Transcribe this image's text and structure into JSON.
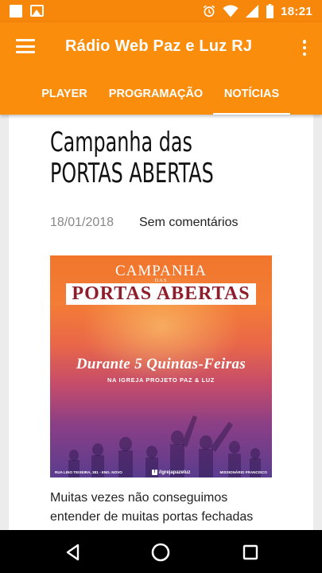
{
  "status_bar": {
    "time": "18:21",
    "left_icons": [
      "notification-square-icon",
      "image-icon"
    ],
    "right_icons": [
      "alarm-icon",
      "wifi-icon",
      "signal-icon",
      "battery-icon"
    ]
  },
  "app_bar": {
    "title": "Rádio Web Paz e Luz RJ",
    "tabs": [
      {
        "label": "PLAYER",
        "active": false
      },
      {
        "label": "PROGRAMAÇÃO",
        "active": false
      },
      {
        "label": "NOTÍCIAS",
        "active": true
      }
    ]
  },
  "post": {
    "title_line1": "Campanha das",
    "title_line2": "PORTAS ABERTAS",
    "date": "18/01/2018",
    "comments": "Sem comentários",
    "body": "Muitas vezes não conseguimos entender de muitas portas fechadas"
  },
  "poster": {
    "campanha": "CAMPANHA",
    "das": "DAS",
    "portas_abertas": "PORTAS ABERTAS",
    "durante": "Durante 5 Quintas-Feiras",
    "igreja": "NA IGREJA PROJETO PAZ & LUZ",
    "address": "RUA LINO TEIXEIRA, 381 - ENG. NOVO",
    "facebook": "/igrejapazeluz",
    "missionary": "MISSIONÁRIO FRANCISCO"
  },
  "colors": {
    "status_bar": "#f6870b",
    "app_bar": "#fb8d0d",
    "background": "#ececec",
    "card": "#ffffff",
    "poster_title": "#8e1e2c"
  }
}
